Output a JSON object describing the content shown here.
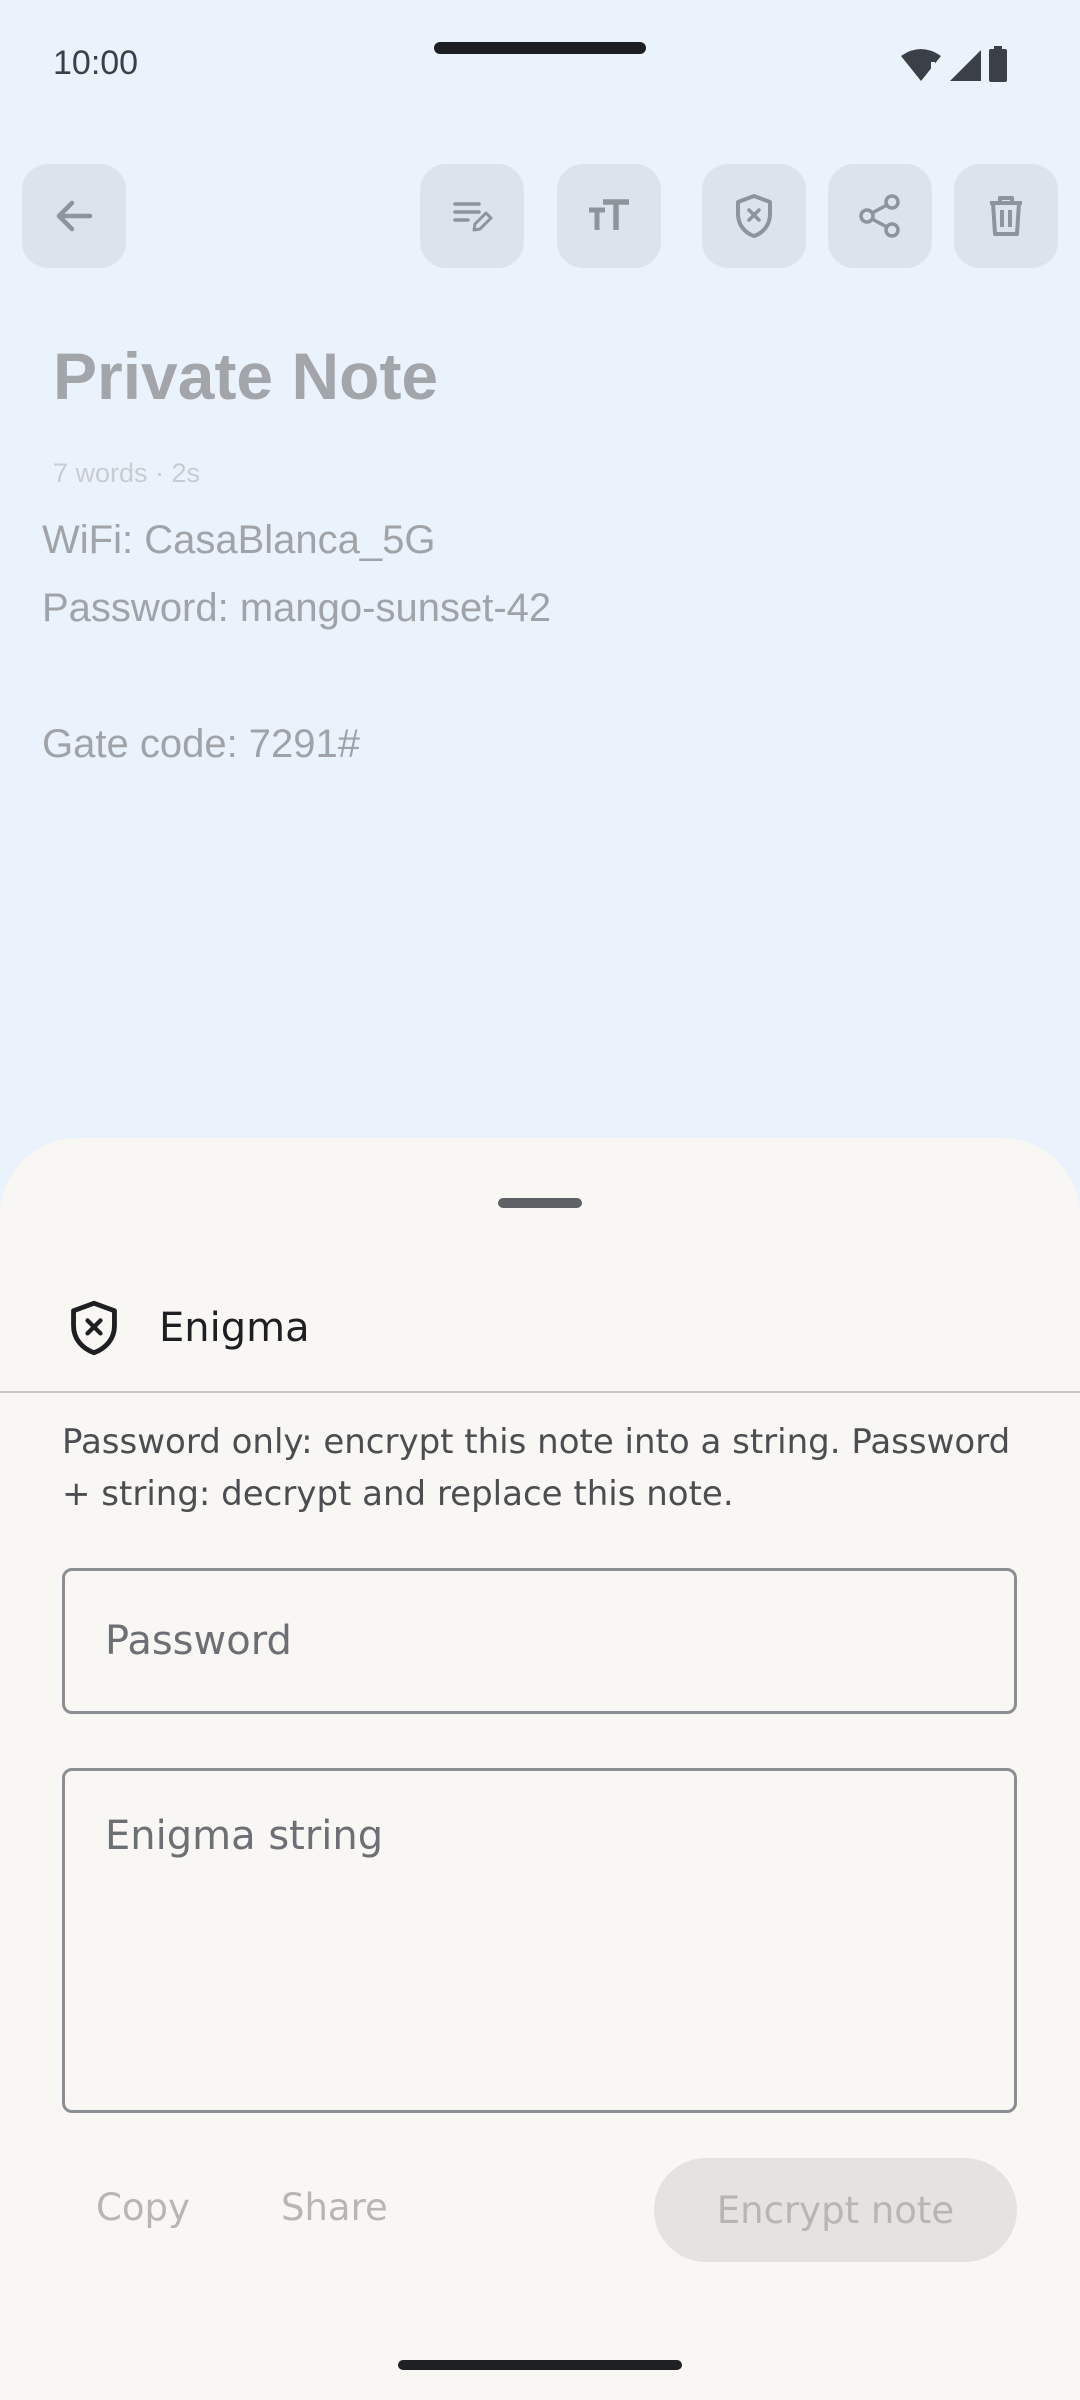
{
  "status_bar": {
    "time": "10:00",
    "icons": [
      "wifi-alert-icon",
      "cell-signal-icon",
      "battery-icon"
    ]
  },
  "toolbar": {
    "buttons": [
      "back-arrow-icon",
      "edit-note-icon",
      "text-size-icon",
      "shield-x-icon",
      "share-icon",
      "trash-icon"
    ]
  },
  "note": {
    "title": "Private Note",
    "meta": "7 words · 2s",
    "lines": [
      "WiFi: CasaBlanca_5G",
      "Password: mango-sunset-42",
      "",
      "Gate code: 7291#"
    ]
  },
  "sheet": {
    "title": "Enigma",
    "icon": "shield-x-icon",
    "description": "Password only: encrypt this note into a string. Password + string: decrypt and replace this note.",
    "password_placeholder": "Password",
    "password_value": "",
    "enigma_placeholder": "Enigma string",
    "enigma_value": "",
    "copy_label": "Copy",
    "share_label": "Share",
    "encrypt_label": "Encrypt note"
  },
  "colors": {
    "background": "#eaf2fc",
    "sheet": "#f8f7f3",
    "toolbar_button": "#dce3ec",
    "disabled_text": "#b7b6b3"
  }
}
